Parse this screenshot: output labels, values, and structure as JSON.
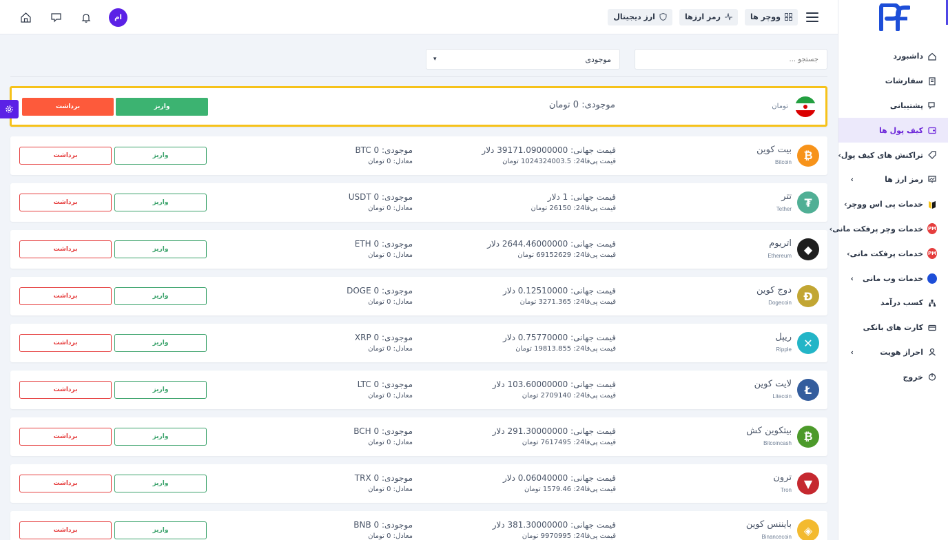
{
  "topbar": {
    "chips": [
      {
        "label": "ووچر ها",
        "icon": "grid-icon"
      },
      {
        "label": "رمز ارزها",
        "icon": "activity-icon"
      },
      {
        "label": "ارز دیجیتال",
        "icon": "shield-icon"
      }
    ],
    "avatar_initials": "ام"
  },
  "sidebar": {
    "items": [
      {
        "label": "داشبورد",
        "icon": "home-icon",
        "chevron": false,
        "active": false
      },
      {
        "label": "سفارشات",
        "icon": "document-icon",
        "chevron": false,
        "active": false
      },
      {
        "label": "پشتیبانی",
        "icon": "chat-icon",
        "chevron": false,
        "active": false
      },
      {
        "label": "کیف پول ها",
        "icon": "wallet-icon",
        "chevron": false,
        "active": true
      },
      {
        "label": "تراکنش های کیف پول",
        "icon": "tag-icon",
        "chevron": true,
        "active": false
      },
      {
        "label": "رمز ارز ها",
        "icon": "chart-screen-icon",
        "chevron": true,
        "active": false
      },
      {
        "label": "خدمات پی اس ووچر",
        "icon": "ps-voucher-icon",
        "chevron": true,
        "active": false
      },
      {
        "label": "خدمات وچر پرفکت مانی",
        "icon": "pm-icon",
        "chevron": true,
        "active": false
      },
      {
        "label": "خدمات پرفکت مانی",
        "icon": "pm-icon",
        "chevron": true,
        "active": false
      },
      {
        "label": "خدمات وب مانی",
        "icon": "webmoney-icon",
        "chevron": true,
        "active": false
      },
      {
        "label": "کسب درآمد",
        "icon": "network-icon",
        "chevron": false,
        "active": false
      },
      {
        "label": "کارت های بانکی",
        "icon": "card-icon",
        "chevron": false,
        "active": false
      },
      {
        "label": "احراز هویت",
        "icon": "user-icon",
        "chevron": true,
        "active": false
      },
      {
        "label": "خروج",
        "icon": "power-icon",
        "chevron": false,
        "active": false
      }
    ],
    "pm_text": "PM"
  },
  "filters": {
    "search_placeholder": "جستجو ...",
    "select_value": "موجودی"
  },
  "toman": {
    "label": "تومان",
    "balance": "موجودی: 0 تومان",
    "deposit": "واریز",
    "withdraw": "برداشت"
  },
  "coins": [
    {
      "name": "بیت کوین",
      "sub": "Bitcoin",
      "price": "قیمت جهانی: 39171.09000000 دلار",
      "local": "قیمت پی‌فا24: 1024324003.5 تومان",
      "balance": "موجودی: 0 BTC",
      "equiv": "معادل: 0 تومان",
      "color": "#f7931a",
      "glyph": "₿"
    },
    {
      "name": "تتر",
      "sub": "Tether",
      "price": "قیمت جهانی: 1 دلار",
      "local": "قیمت پی‌فا24: 26150 تومان",
      "balance": "موجودی: 0 USDT",
      "equiv": "معادل: 0 تومان",
      "color": "#50af95",
      "glyph": "₮"
    },
    {
      "name": "اتریوم",
      "sub": "Ethereum",
      "price": "قیمت جهانی: 2644.46000000 دلار",
      "local": "قیمت پی‌فا24: 69152629 تومان",
      "balance": "موجودی: 0 ETH",
      "equiv": "معادل: 0 تومان",
      "color": "#1e1e1e",
      "glyph": "◆"
    },
    {
      "name": "دوج کوین",
      "sub": "Dogecoin",
      "price": "قیمت جهانی: 0.12510000 دلار",
      "local": "قیمت پی‌فا24: 3271.365 تومان",
      "balance": "موجودی: 0 DOGE",
      "equiv": "معادل: 0 تومان",
      "color": "#c2a633",
      "glyph": "Ð"
    },
    {
      "name": "ریپل",
      "sub": "Ripple",
      "price": "قیمت جهانی: 0.75770000 دلار",
      "local": "قیمت پی‌فا24: 19813.855 تومان",
      "balance": "موجودی: 0 XRP",
      "equiv": "معادل: 0 تومان",
      "color": "#23b5c7",
      "glyph": "✕"
    },
    {
      "name": "لایت کوین",
      "sub": "Litecoin",
      "price": "قیمت جهانی: 103.60000000 دلار",
      "local": "قیمت پی‌فا24: 2709140 تومان",
      "balance": "موجودی: 0 LTC",
      "equiv": "معادل: 0 تومان",
      "color": "#345d9d",
      "glyph": "Ł"
    },
    {
      "name": "بیتکوین کش",
      "sub": "Bitcoincash",
      "price": "قیمت جهانی: 291.30000000 دلار",
      "local": "قیمت پی‌فا24: 7617495 تومان",
      "balance": "موجودی: 0 BCH",
      "equiv": "معادل: 0 تومان",
      "color": "#4c9a2a",
      "glyph": "₿"
    },
    {
      "name": "ترون",
      "sub": "Tron",
      "price": "قیمت جهانی: 0.06040000 دلار",
      "local": "قیمت پی‌فا24: 1579.46 تومان",
      "balance": "موجودی: 0 TRX",
      "equiv": "معادل: 0 تومان",
      "color": "#c5282f",
      "glyph": "▼"
    },
    {
      "name": "بایننس کوین",
      "sub": "Binancecoin",
      "price": "قیمت جهانی: 381.30000000 دلار",
      "local": "قیمت پی‌فا24: 9970995 تومان",
      "balance": "موجودی: 0 BNB",
      "equiv": "معادل: 0 تومان",
      "color": "#f3ba2f",
      "glyph": "◈"
    }
  ],
  "buttons": {
    "deposit": "واریز",
    "withdraw": "برداشت"
  }
}
